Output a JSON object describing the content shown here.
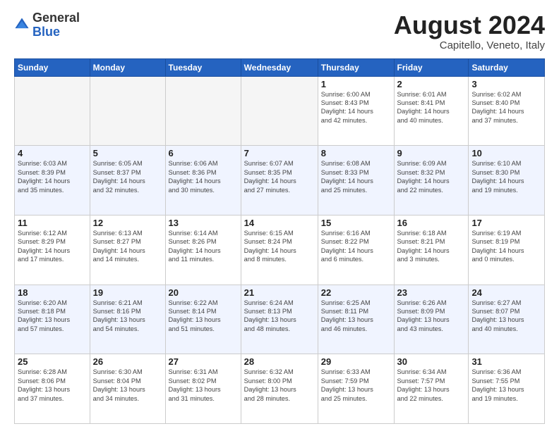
{
  "header": {
    "logo_general": "General",
    "logo_blue": "Blue",
    "month_title": "August 2024",
    "subtitle": "Capitello, Veneto, Italy"
  },
  "days_of_week": [
    "Sunday",
    "Monday",
    "Tuesday",
    "Wednesday",
    "Thursday",
    "Friday",
    "Saturday"
  ],
  "weeks": [
    [
      {
        "day": "",
        "info": ""
      },
      {
        "day": "",
        "info": ""
      },
      {
        "day": "",
        "info": ""
      },
      {
        "day": "",
        "info": ""
      },
      {
        "day": "1",
        "info": "Sunrise: 6:00 AM\nSunset: 8:43 PM\nDaylight: 14 hours\nand 42 minutes."
      },
      {
        "day": "2",
        "info": "Sunrise: 6:01 AM\nSunset: 8:41 PM\nDaylight: 14 hours\nand 40 minutes."
      },
      {
        "day": "3",
        "info": "Sunrise: 6:02 AM\nSunset: 8:40 PM\nDaylight: 14 hours\nand 37 minutes."
      }
    ],
    [
      {
        "day": "4",
        "info": "Sunrise: 6:03 AM\nSunset: 8:39 PM\nDaylight: 14 hours\nand 35 minutes."
      },
      {
        "day": "5",
        "info": "Sunrise: 6:05 AM\nSunset: 8:37 PM\nDaylight: 14 hours\nand 32 minutes."
      },
      {
        "day": "6",
        "info": "Sunrise: 6:06 AM\nSunset: 8:36 PM\nDaylight: 14 hours\nand 30 minutes."
      },
      {
        "day": "7",
        "info": "Sunrise: 6:07 AM\nSunset: 8:35 PM\nDaylight: 14 hours\nand 27 minutes."
      },
      {
        "day": "8",
        "info": "Sunrise: 6:08 AM\nSunset: 8:33 PM\nDaylight: 14 hours\nand 25 minutes."
      },
      {
        "day": "9",
        "info": "Sunrise: 6:09 AM\nSunset: 8:32 PM\nDaylight: 14 hours\nand 22 minutes."
      },
      {
        "day": "10",
        "info": "Sunrise: 6:10 AM\nSunset: 8:30 PM\nDaylight: 14 hours\nand 19 minutes."
      }
    ],
    [
      {
        "day": "11",
        "info": "Sunrise: 6:12 AM\nSunset: 8:29 PM\nDaylight: 14 hours\nand 17 minutes."
      },
      {
        "day": "12",
        "info": "Sunrise: 6:13 AM\nSunset: 8:27 PM\nDaylight: 14 hours\nand 14 minutes."
      },
      {
        "day": "13",
        "info": "Sunrise: 6:14 AM\nSunset: 8:26 PM\nDaylight: 14 hours\nand 11 minutes."
      },
      {
        "day": "14",
        "info": "Sunrise: 6:15 AM\nSunset: 8:24 PM\nDaylight: 14 hours\nand 8 minutes."
      },
      {
        "day": "15",
        "info": "Sunrise: 6:16 AM\nSunset: 8:22 PM\nDaylight: 14 hours\nand 6 minutes."
      },
      {
        "day": "16",
        "info": "Sunrise: 6:18 AM\nSunset: 8:21 PM\nDaylight: 14 hours\nand 3 minutes."
      },
      {
        "day": "17",
        "info": "Sunrise: 6:19 AM\nSunset: 8:19 PM\nDaylight: 14 hours\nand 0 minutes."
      }
    ],
    [
      {
        "day": "18",
        "info": "Sunrise: 6:20 AM\nSunset: 8:18 PM\nDaylight: 13 hours\nand 57 minutes."
      },
      {
        "day": "19",
        "info": "Sunrise: 6:21 AM\nSunset: 8:16 PM\nDaylight: 13 hours\nand 54 minutes."
      },
      {
        "day": "20",
        "info": "Sunrise: 6:22 AM\nSunset: 8:14 PM\nDaylight: 13 hours\nand 51 minutes."
      },
      {
        "day": "21",
        "info": "Sunrise: 6:24 AM\nSunset: 8:13 PM\nDaylight: 13 hours\nand 48 minutes."
      },
      {
        "day": "22",
        "info": "Sunrise: 6:25 AM\nSunset: 8:11 PM\nDaylight: 13 hours\nand 46 minutes."
      },
      {
        "day": "23",
        "info": "Sunrise: 6:26 AM\nSunset: 8:09 PM\nDaylight: 13 hours\nand 43 minutes."
      },
      {
        "day": "24",
        "info": "Sunrise: 6:27 AM\nSunset: 8:07 PM\nDaylight: 13 hours\nand 40 minutes."
      }
    ],
    [
      {
        "day": "25",
        "info": "Sunrise: 6:28 AM\nSunset: 8:06 PM\nDaylight: 13 hours\nand 37 minutes."
      },
      {
        "day": "26",
        "info": "Sunrise: 6:30 AM\nSunset: 8:04 PM\nDaylight: 13 hours\nand 34 minutes."
      },
      {
        "day": "27",
        "info": "Sunrise: 6:31 AM\nSunset: 8:02 PM\nDaylight: 13 hours\nand 31 minutes."
      },
      {
        "day": "28",
        "info": "Sunrise: 6:32 AM\nSunset: 8:00 PM\nDaylight: 13 hours\nand 28 minutes."
      },
      {
        "day": "29",
        "info": "Sunrise: 6:33 AM\nSunset: 7:59 PM\nDaylight: 13 hours\nand 25 minutes."
      },
      {
        "day": "30",
        "info": "Sunrise: 6:34 AM\nSunset: 7:57 PM\nDaylight: 13 hours\nand 22 minutes."
      },
      {
        "day": "31",
        "info": "Sunrise: 6:36 AM\nSunset: 7:55 PM\nDaylight: 13 hours\nand 19 minutes."
      }
    ]
  ]
}
